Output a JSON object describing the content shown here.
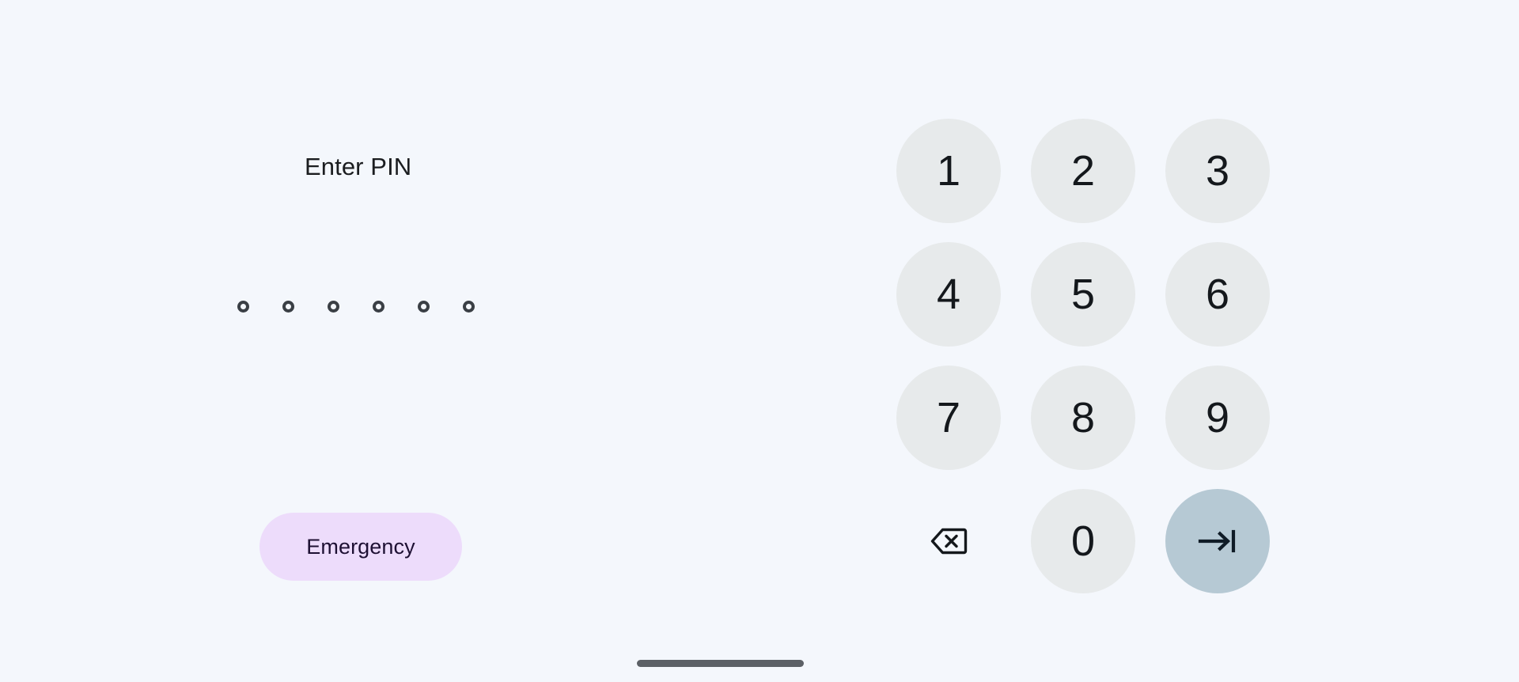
{
  "screen": {
    "name": "android-pin-lock-screen",
    "background_color": "#f4f7fc"
  },
  "prompt": {
    "title": "Enter PIN"
  },
  "pin_entry": {
    "dot_count": 6,
    "filled_count": 0,
    "dot_color": "#3a3f45",
    "dots": [
      {
        "filled": false
      },
      {
        "filled": false
      },
      {
        "filled": false
      },
      {
        "filled": false
      },
      {
        "filled": false
      },
      {
        "filled": false
      }
    ]
  },
  "emergency": {
    "label": "Emergency",
    "background_color": "#eddcfb",
    "text_color": "#1e1033"
  },
  "keypad": {
    "key_background_color": "#e7eaeb",
    "key_text_color": "#14181c",
    "enter_background_color": "#b6c9d4",
    "keys": [
      {
        "label": "1",
        "name": "keypad-key-1",
        "type": "digit"
      },
      {
        "label": "2",
        "name": "keypad-key-2",
        "type": "digit"
      },
      {
        "label": "3",
        "name": "keypad-key-3",
        "type": "digit"
      },
      {
        "label": "4",
        "name": "keypad-key-4",
        "type": "digit"
      },
      {
        "label": "5",
        "name": "keypad-key-5",
        "type": "digit"
      },
      {
        "label": "6",
        "name": "keypad-key-6",
        "type": "digit"
      },
      {
        "label": "7",
        "name": "keypad-key-7",
        "type": "digit"
      },
      {
        "label": "8",
        "name": "keypad-key-8",
        "type": "digit"
      },
      {
        "label": "9",
        "name": "keypad-key-9",
        "type": "digit"
      },
      {
        "label": "",
        "name": "backspace-icon",
        "type": "backspace"
      },
      {
        "label": "0",
        "name": "keypad-key-0",
        "type": "digit"
      },
      {
        "label": "",
        "name": "enter-icon",
        "type": "enter"
      }
    ],
    "row1": {
      "k1": "1",
      "k2": "2",
      "k3": "3"
    },
    "row2": {
      "k1": "4",
      "k2": "5",
      "k3": "6"
    },
    "row3": {
      "k1": "7",
      "k2": "8",
      "k3": "9"
    },
    "row4": {
      "zero": "0"
    }
  },
  "navigation": {
    "home_indicator_color": "#5c6066"
  }
}
